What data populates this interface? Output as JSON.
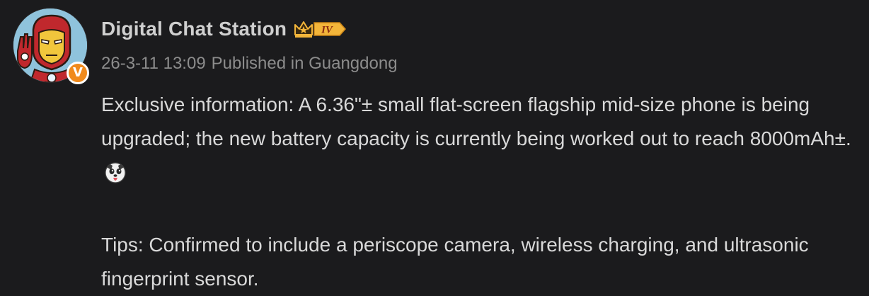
{
  "post": {
    "author": {
      "name": "Digital Chat Station",
      "level_badge": "IV",
      "verified_badge": "V",
      "avatar_icon": "iron-man-avatar-icon",
      "crown_icon": "crown-icon"
    },
    "meta": {
      "timestamp": "26-3-11 13:09",
      "location": "Published in Guangdong"
    },
    "body": {
      "paragraph1": "Exclusive information: A 6.36\"± small flat-screen flagship mid-size phone is being upgraded; the new battery capacity is currently being worked out to reach 8000mAh±.",
      "paragraph1_emoji": "dog-face-tongue-emoji",
      "paragraph2": "Tips: Confirmed to include a periscope camera, wireless charging, and ultrasonic fingerprint sensor."
    }
  },
  "colors": {
    "background": "#1b1b1d",
    "name": "#cfcfcf",
    "meta": "#8c8c8c",
    "body": "#d9d9d9",
    "badge_orange": "#f08a1c",
    "level_gold": "#f3b53a"
  }
}
